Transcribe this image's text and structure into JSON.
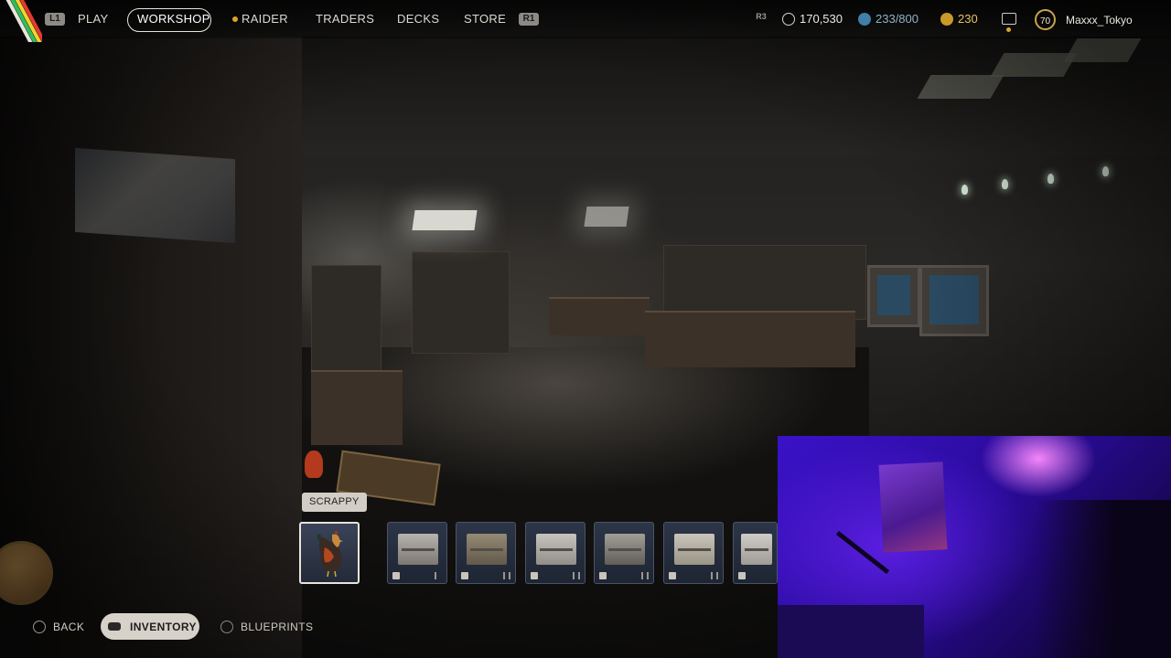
{
  "topbar": {
    "left_shoulder_key": "L1",
    "right_shoulder_key": "R1",
    "stick_key": "R3",
    "nav": [
      {
        "label": "PLAY"
      },
      {
        "label": "WORKSHOP",
        "active": true
      },
      {
        "label": "RAIDER"
      },
      {
        "label": "TRADERS"
      },
      {
        "label": "DECKS"
      },
      {
        "label": "STORE"
      }
    ],
    "currency": {
      "credits": "170,530",
      "capacity": "233/800",
      "coins": "230"
    },
    "profile": {
      "level": "70",
      "username": "Maxxx_Tokyo"
    }
  },
  "hotbar": {
    "tooltip": "SCRAPPY",
    "selected_index": 0,
    "slots": [
      {
        "icon": "rooster-icon"
      },
      {
        "icon": "workbench-icon"
      },
      {
        "icon": "workbench-icon"
      },
      {
        "icon": "workbench-icon"
      },
      {
        "icon": "workbench-icon"
      },
      {
        "icon": "workbench-icon"
      },
      {
        "icon": "workbench-icon"
      }
    ]
  },
  "controls": {
    "back": "BACK",
    "inventory": "INVENTORY",
    "blueprints": "BLUEPRINTS"
  },
  "colors": {
    "accent_gold": "#c8a44a",
    "hotbar_slot": "#2c3648",
    "active_pill": "#d6d2ca",
    "webcam_purple": "#3b12c8"
  }
}
